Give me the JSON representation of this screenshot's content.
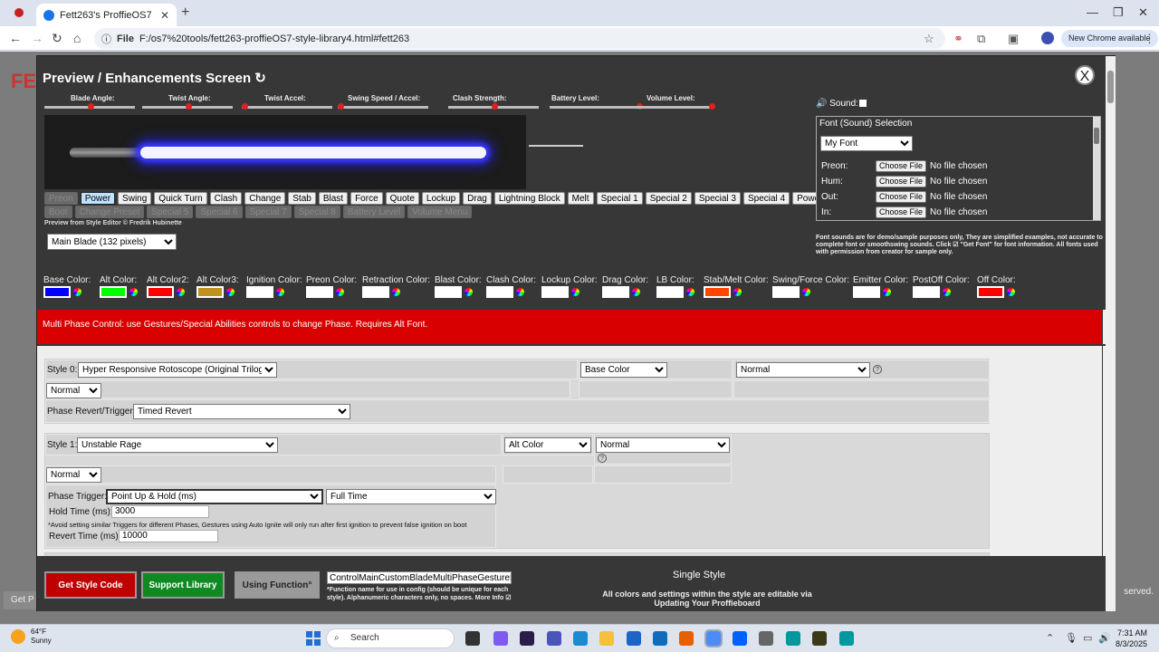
{
  "browser": {
    "tab_title": "Fett263's ProffieOS7 Style Libra",
    "url_tag": "File",
    "url": "F:/os7%20tools/fett263-proffieOS7-style-library4.html#fett263",
    "new_chrome": "New Chrome available"
  },
  "page_bg": {
    "get_label": "Get P",
    "served": "served."
  },
  "modal": {
    "title": "Preview / Enhancements Screen ↻",
    "close": "X",
    "sliders": [
      {
        "label": "Blade Angle:",
        "value": 0.5
      },
      {
        "label": "Twist Angle:",
        "value": 0.5
      },
      {
        "label": "Twist Accel:",
        "value": 0.0
      },
      {
        "label": "Swing Speed / Accel:",
        "value": 0.0
      },
      {
        "label": "Clash Strength:",
        "value": 0.5
      },
      {
        "label": "Battery Level:",
        "value": 1.0
      },
      {
        "label": "Volume Level:",
        "value": 1.0
      }
    ],
    "buttons_row1": [
      {
        "label": "Preon",
        "state": "disabled"
      },
      {
        "label": "Power",
        "state": "active"
      },
      {
        "label": "Swing",
        "state": "normal"
      },
      {
        "label": "Quick Turn",
        "state": "normal"
      },
      {
        "label": "Clash",
        "state": "normal"
      },
      {
        "label": "Change",
        "state": "normal"
      },
      {
        "label": "Stab",
        "state": "normal"
      },
      {
        "label": "Blast",
        "state": "normal"
      },
      {
        "label": "Force",
        "state": "normal"
      },
      {
        "label": "Quote",
        "state": "normal"
      },
      {
        "label": "Lockup",
        "state": "normal"
      },
      {
        "label": "Drag",
        "state": "normal"
      },
      {
        "label": "Lightning Block",
        "state": "normal"
      },
      {
        "label": "Melt",
        "state": "normal"
      },
      {
        "label": "Special 1",
        "state": "normal"
      },
      {
        "label": "Special 2",
        "state": "normal"
      },
      {
        "label": "Special 3",
        "state": "normal"
      },
      {
        "label": "Special 4",
        "state": "normal"
      },
      {
        "label": "PowerSave",
        "state": "normal"
      }
    ],
    "buttons_row2": [
      "Boot",
      "Change Preset",
      "Special 5",
      "Special 6",
      "Special 7",
      "Special 8",
      "Battery Level",
      "Volume Menu"
    ],
    "credit": "Preview from Style Editor © Fredrik Hubinette",
    "blade_select": "Main Blade (132 pixels)",
    "sound": {
      "label": "🔊 Sound:",
      "panel_title": "Font (Sound) Selection",
      "font_select": "My Font",
      "rows": [
        {
          "label": "Preon:",
          "button": "Choose File",
          "status": "No file chosen"
        },
        {
          "label": "Hum:",
          "button": "Choose File",
          "status": "No file chosen"
        },
        {
          "label": "Out:",
          "button": "Choose File",
          "status": "No file chosen"
        },
        {
          "label": "In:",
          "button": "Choose File",
          "status": "No file chosen"
        }
      ],
      "note": "Font sounds are for demo/sample purposes only, They are simplified examples, not accurate to complete font or smoothswing sounds. Click ☑ \"Get Font\" for font information. All fonts used with permission from creator for sample only."
    },
    "colors": [
      {
        "label": "Base Color:",
        "color": "#0000ff"
      },
      {
        "label": "Alt Color:",
        "color": "#00ff00"
      },
      {
        "label": "Alt Color2:",
        "color": "#ff0000"
      },
      {
        "label": "Alt Color3:",
        "color": "#c09020"
      },
      {
        "label": "Ignition Color:",
        "color": "#ffffff"
      },
      {
        "label": "Preon Color:",
        "color": "#ffffff"
      },
      {
        "label": "Retraction Color:",
        "color": "#ffffff"
      },
      {
        "label": "Blast Color:",
        "color": "#ffffff"
      },
      {
        "label": "Clash Color:",
        "color": "#ffffff"
      },
      {
        "label": "Lockup Color:",
        "color": "#ffffff"
      },
      {
        "label": "Drag Color:",
        "color": "#ffffff"
      },
      {
        "label": "LB Color:",
        "color": "#ffffff"
      },
      {
        "label": "Stab/Melt Color:",
        "color": "#ff4500"
      },
      {
        "label": "Swing/Force Color:",
        "color": "#ffffff"
      },
      {
        "label": "Emitter Color:",
        "color": "#ffffff"
      },
      {
        "label": "PostOff Color:",
        "color": "#ffffff"
      },
      {
        "label": "Off Color:",
        "color": "#ff0000"
      }
    ],
    "banner": "Multi Phase Control: use Gestures/Special Abilities controls to change Phase. Requires Alt Font.",
    "style0": {
      "label": "Style 0:",
      "style": "Hyper Responsive Rotoscope (Original Trilogy)",
      "color": "Base Color",
      "mode": "Normal",
      "sub_mode": "Normal",
      "trigger_label": "Phase Revert/Trigger:",
      "trigger": "Timed Revert",
      "help": "?"
    },
    "style1": {
      "label": "Style 1:",
      "style": "Unstable Rage",
      "color": "Alt Color",
      "mode": "Normal",
      "sub_mode": "Normal",
      "help": "?",
      "trigger_label": "Phase Trigger:",
      "trigger": "Point Up & Hold (ms)",
      "timing": "Full Time",
      "hold_label": "Hold Time (ms):",
      "hold_value": "3000",
      "warning": "*Avoid setting similar Triggers for different Phases, Gestures using Auto Ignite will only run after first ignition to prevent false ignition on boot",
      "revert_label": "Revert Time (ms):",
      "revert_value": "10000"
    },
    "bottom": {
      "get_code": "Get Style Code",
      "support": "Support Library",
      "using_function": "Using Function°",
      "function_name": "ControlMainCustomBladeMultiPhaseGestureBas",
      "function_note": "*Function name for use in config (should be unique for each style). Alphanumeric characters only, no spaces. More Info ☑",
      "single_style": "Single Style",
      "editable": "All colors and settings within the style are editable via Updating Your Proffieboard"
    }
  },
  "taskbar": {
    "temp": "64°F",
    "weather": "Sunny",
    "search": "Search",
    "time": "7:31 AM",
    "date": "8/3/2025"
  }
}
